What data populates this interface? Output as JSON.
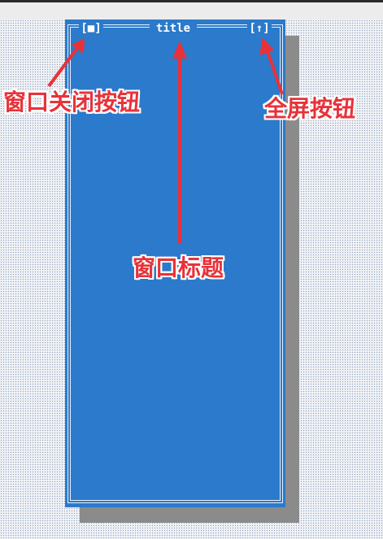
{
  "window": {
    "close_button": "[■]",
    "title": "title",
    "maximize_button": "[↑]"
  },
  "callouts": {
    "close_label": "窗口关闭按钮",
    "maximize_label": "全屏按钮",
    "title_label": "窗口标题"
  },
  "colors": {
    "window_bg": "#2b7acb",
    "frame": "#e9f1fb",
    "annotation": "#e8323a",
    "shadow": "#8b8b8b"
  }
}
